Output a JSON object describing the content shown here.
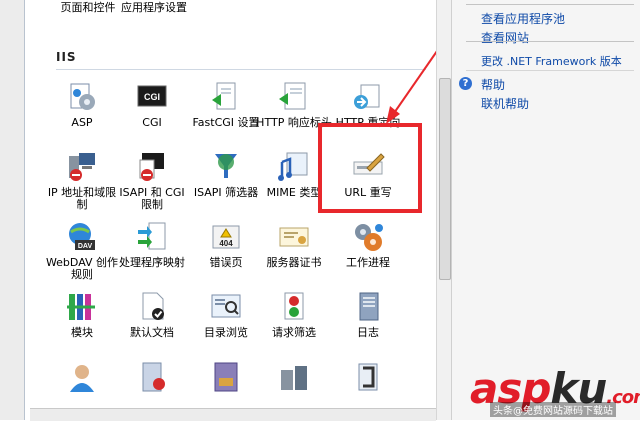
{
  "top_row": {
    "items": [
      {
        "label": "页面和控件"
      },
      {
        "label": "应用程序设置"
      }
    ]
  },
  "section": {
    "title": "IIS"
  },
  "features": [
    {
      "label": "ASP",
      "icon": "asp-icon"
    },
    {
      "label": "CGI",
      "icon": "cgi-icon"
    },
    {
      "label": "FastCGI 设置",
      "icon": "fastcgi-icon"
    },
    {
      "label": "HTTP 响应标头",
      "icon": "http-headers-icon"
    },
    {
      "label": "HTTP 重定向",
      "icon": "http-redirect-icon"
    },
    {
      "label": "IP 地址和域限制",
      "icon": "ip-restrictions-icon"
    },
    {
      "label": "ISAPI 和 CGI 限制",
      "icon": "isapi-cgi-icon"
    },
    {
      "label": "ISAPI 筛选器",
      "icon": "isapi-filter-icon"
    },
    {
      "label": "MIME 类型",
      "icon": "mime-icon"
    },
    {
      "label": "URL 重写",
      "icon": "url-rewrite-icon"
    },
    {
      "label": "WebDAV 创作规则",
      "icon": "webdav-icon"
    },
    {
      "label": "处理程序映射",
      "icon": "handler-icon"
    },
    {
      "label": "错误页",
      "icon": "error-page-icon"
    },
    {
      "label": "服务器证书",
      "icon": "certificate-icon"
    },
    {
      "label": "工作进程",
      "icon": "worker-process-icon"
    },
    {
      "label": "模块",
      "icon": "modules-icon"
    },
    {
      "label": "默认文档",
      "icon": "default-doc-icon"
    },
    {
      "label": "目录浏览",
      "icon": "dir-browse-icon"
    },
    {
      "label": "请求筛选",
      "icon": "request-filter-icon"
    },
    {
      "label": "日志",
      "icon": "logging-icon"
    }
  ],
  "actions": {
    "links": [
      "查看应用程序池",
      "查看网站",
      "更改 .NET Framework 版本",
      "帮助",
      "联机帮助"
    ]
  },
  "watermark": {
    "text_red1": "asp",
    "text_dark": "ku",
    "text_red2": ".com",
    "sub": "头条@免费网站源码下载站"
  },
  "colors": {
    "highlight": "#e8282c",
    "link": "#0f4aa8"
  }
}
